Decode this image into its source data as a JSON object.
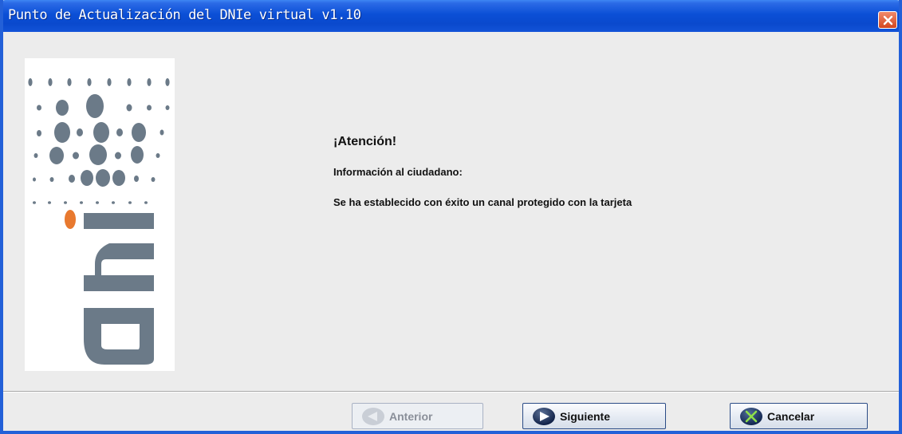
{
  "window": {
    "title": "Punto de Actualización del DNIe virtual v1.10"
  },
  "logo": {
    "text": "dni",
    "colors": {
      "gray": "#6b7a88",
      "orange": "#e8792f",
      "background": "#ffffff"
    }
  },
  "message": {
    "heading": "¡Atención!",
    "subheading": "Información al ciudadano:",
    "body": "Se ha establecido con éxito un canal protegido con la tarjeta"
  },
  "buttons": {
    "previous": {
      "label": "Anterior",
      "icon": "arrow-left-icon",
      "enabled": false
    },
    "next": {
      "label": "Siguiente",
      "icon": "arrow-right-icon",
      "enabled": true
    },
    "cancel": {
      "label": "Cancelar",
      "icon": "cancel-x-icon",
      "enabled": true
    }
  },
  "colors": {
    "titlebar": "#0a49cd",
    "window_bg": "#ececec",
    "close_button": "#d4461f"
  }
}
